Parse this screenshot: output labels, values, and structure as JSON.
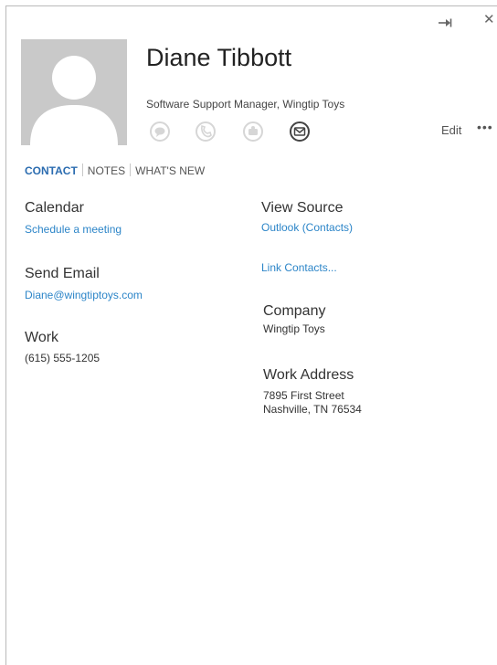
{
  "window": {
    "pin_glyph": "⇥",
    "close_glyph": "✕"
  },
  "contact": {
    "name": "Diane Tibbott",
    "title_company": "Software Support Manager, Wingtip Toys"
  },
  "actions": [
    "im-icon",
    "phone-icon",
    "video-icon",
    "email-icon"
  ],
  "header": {
    "edit_label": "Edit",
    "more_label": "•••"
  },
  "tabs": {
    "contact": "CONTACT",
    "notes": "NOTES",
    "whats_new": "WHAT'S NEW"
  },
  "left": {
    "calendar": {
      "label": "Calendar",
      "link": "Schedule a meeting"
    },
    "send_email": {
      "label": "Send Email",
      "link": "Diane@wingtiptoys.com"
    },
    "work": {
      "label": "Work",
      "value": "(615) 555-1205"
    }
  },
  "right": {
    "view_source": {
      "label": "View Source",
      "link": "Outlook (Contacts)"
    },
    "link_contacts": "Link Contacts...",
    "company": {
      "label": "Company",
      "value": "Wingtip Toys"
    },
    "work_address": {
      "label": "Work Address",
      "line1": "7895 First Street",
      "line2": "Nashville, TN 76534"
    }
  },
  "colors": {
    "link": "#2c85c8",
    "active_tab": "#2b6cb0",
    "avatar_bg": "#c9c9c9",
    "disabled_icon": "#d6d6d6"
  }
}
